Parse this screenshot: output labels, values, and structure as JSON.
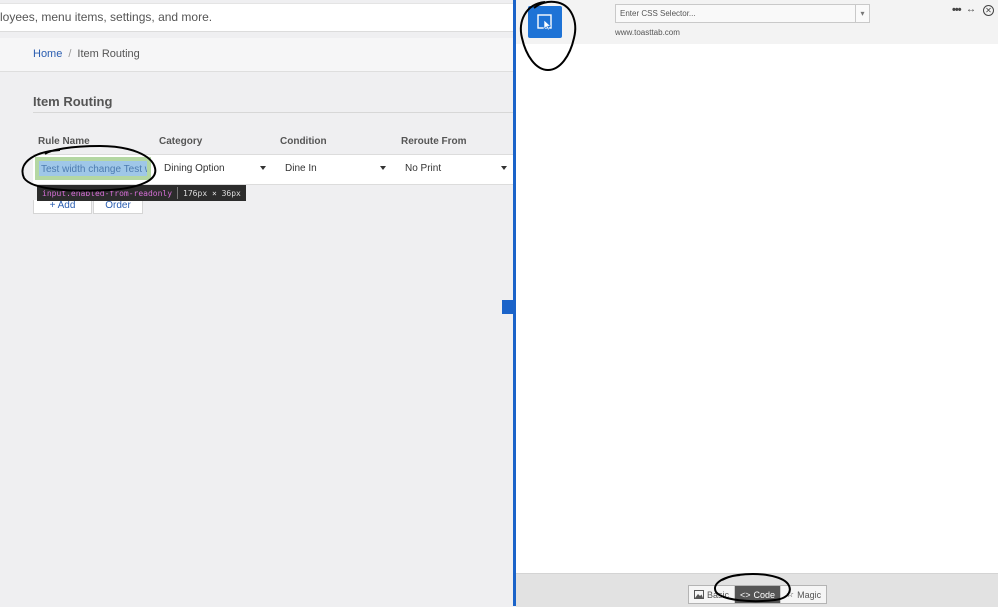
{
  "app": {
    "search_text": "loyees, menu items, settings, and more.",
    "breadcrumb": {
      "home": "Home",
      "separator": "/",
      "current": "Item Routing"
    },
    "page_title": "Item Routing",
    "table": {
      "columns": [
        "Rule Name",
        "Category",
        "Condition",
        "Reroute From"
      ],
      "row": {
        "rule_name": "Test width change Test w",
        "category": "Dining Option",
        "condition": "Dine In",
        "reroute_from": "No Print"
      }
    },
    "inspector_tooltip": {
      "selector": "input.enabled-from-readonly",
      "dimensions": "176px × 36px"
    },
    "buttons": {
      "add": "+ Add",
      "order": "Order"
    }
  },
  "panel": {
    "css_selector_placeholder": "Enter CSS Selector...",
    "domain": "www.toasttab.com",
    "tabs": [
      {
        "label": "Basic",
        "icon": "image-icon",
        "active": false
      },
      {
        "label": "Code",
        "icon": "code-icon",
        "active": true
      },
      {
        "label": "Magic",
        "icon": "star-icon",
        "active": false
      }
    ]
  },
  "colors": {
    "accent": "#1a63c9",
    "picker": "#1e73d6",
    "link": "#2a5db0"
  }
}
